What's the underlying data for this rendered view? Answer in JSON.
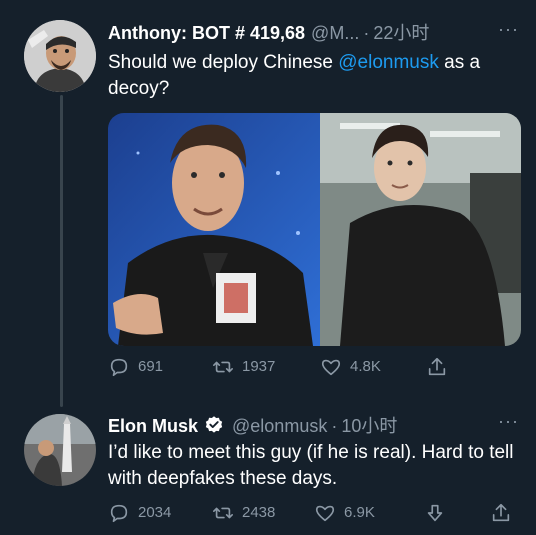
{
  "tweet1": {
    "author_name": "Anthony: BOT # 419,68",
    "handle": "@M...",
    "separator": "·",
    "time": "22小时",
    "text_before": "Should we deploy Chinese ",
    "mention": "@elonmusk",
    "text_after": " as a decoy?",
    "stats": {
      "replies": "691",
      "retweets": "1937",
      "likes": "4.8K"
    }
  },
  "tweet2": {
    "author_name": "Elon Musk",
    "verified": true,
    "handle": "@elonmusk",
    "separator": "·",
    "time": "10小时",
    "text": "I’d like to meet this guy (if he is real). Hard to tell with deepfakes these days.",
    "stats": {
      "replies": "2034",
      "retweets": "2438",
      "likes": "6.9K"
    }
  },
  "more_label": "···",
  "icons": [
    "reply-icon",
    "retweet-icon",
    "like-icon",
    "share-icon",
    "downvote-icon",
    "verified-badge-icon"
  ],
  "colors": {
    "background": "#15202b",
    "text": "#ffffff",
    "secondary": "#8b98a5",
    "accent": "#1d9bf0",
    "thread_line": "#38444d"
  }
}
